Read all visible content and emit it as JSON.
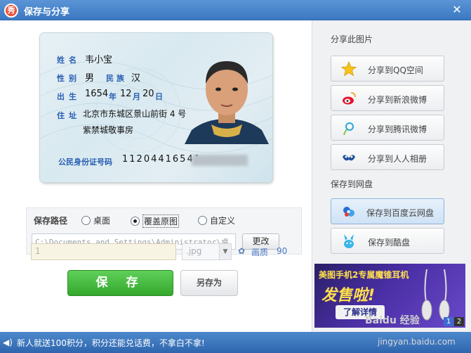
{
  "window": {
    "title": "保存与分享",
    "logo_char": "秀"
  },
  "idcard": {
    "labels": {
      "name": "姓名",
      "gender": "性别",
      "ethnicity": "民族",
      "birth": "出生",
      "address": "住址",
      "id_number": "公民身份证号码"
    },
    "name": "韦小宝",
    "gender": "男",
    "ethnicity": "汉",
    "birth_year": "1654",
    "birth_year_unit": "年",
    "birth_month": "12",
    "birth_month_unit": "月",
    "birth_day": "20",
    "birth_day_unit": "日",
    "address_line1": "北京市东城区景山前街 4 号",
    "address_line2": "紫禁城敬事房",
    "id_number": "11204416541"
  },
  "save_path": {
    "label": "保存路径",
    "options": [
      "桌面",
      "覆盖原图",
      "自定义"
    ],
    "selected": "覆盖原图",
    "path_value": "C:\\Documents and Settings\\Administrator\\桌",
    "change_button": "更改"
  },
  "file": {
    "name_value": "1",
    "format_value": ".jpg",
    "quality_label": "画质",
    "quality_value": "90"
  },
  "actions": {
    "save": "保 存",
    "save_as": "另存为"
  },
  "share": {
    "heading": "分享此图片",
    "items": [
      {
        "label": "分享到QQ空间",
        "icon": "star-icon"
      },
      {
        "label": "分享到新浪微博",
        "icon": "weibo-icon"
      },
      {
        "label": "分享到腾讯微博",
        "icon": "tencent-weibo-icon"
      },
      {
        "label": "分享到人人相册",
        "icon": "renren-icon"
      }
    ]
  },
  "cloud": {
    "heading": "保存到网盘",
    "items": [
      {
        "label": "保存到百度云网盘",
        "icon": "baidu-cloud-icon"
      },
      {
        "label": "保存到酷盘",
        "icon": "kupan-icon"
      }
    ]
  },
  "ad": {
    "line1": "美图手机2专属魔锥耳机",
    "line2": "发售啦!",
    "button": "了解详情",
    "pages": [
      "1",
      "2"
    ]
  },
  "status": {
    "text": "新人就送100积分，积分还能兑话费，不拿白不拿!"
  },
  "watermark": {
    "text": "Baidu 经验",
    "url": "jingyan.baidu.com"
  },
  "colors": {
    "titlebar": "#3a78c2",
    "save_green": "#34a72c",
    "link_blue": "#4a79c0"
  }
}
